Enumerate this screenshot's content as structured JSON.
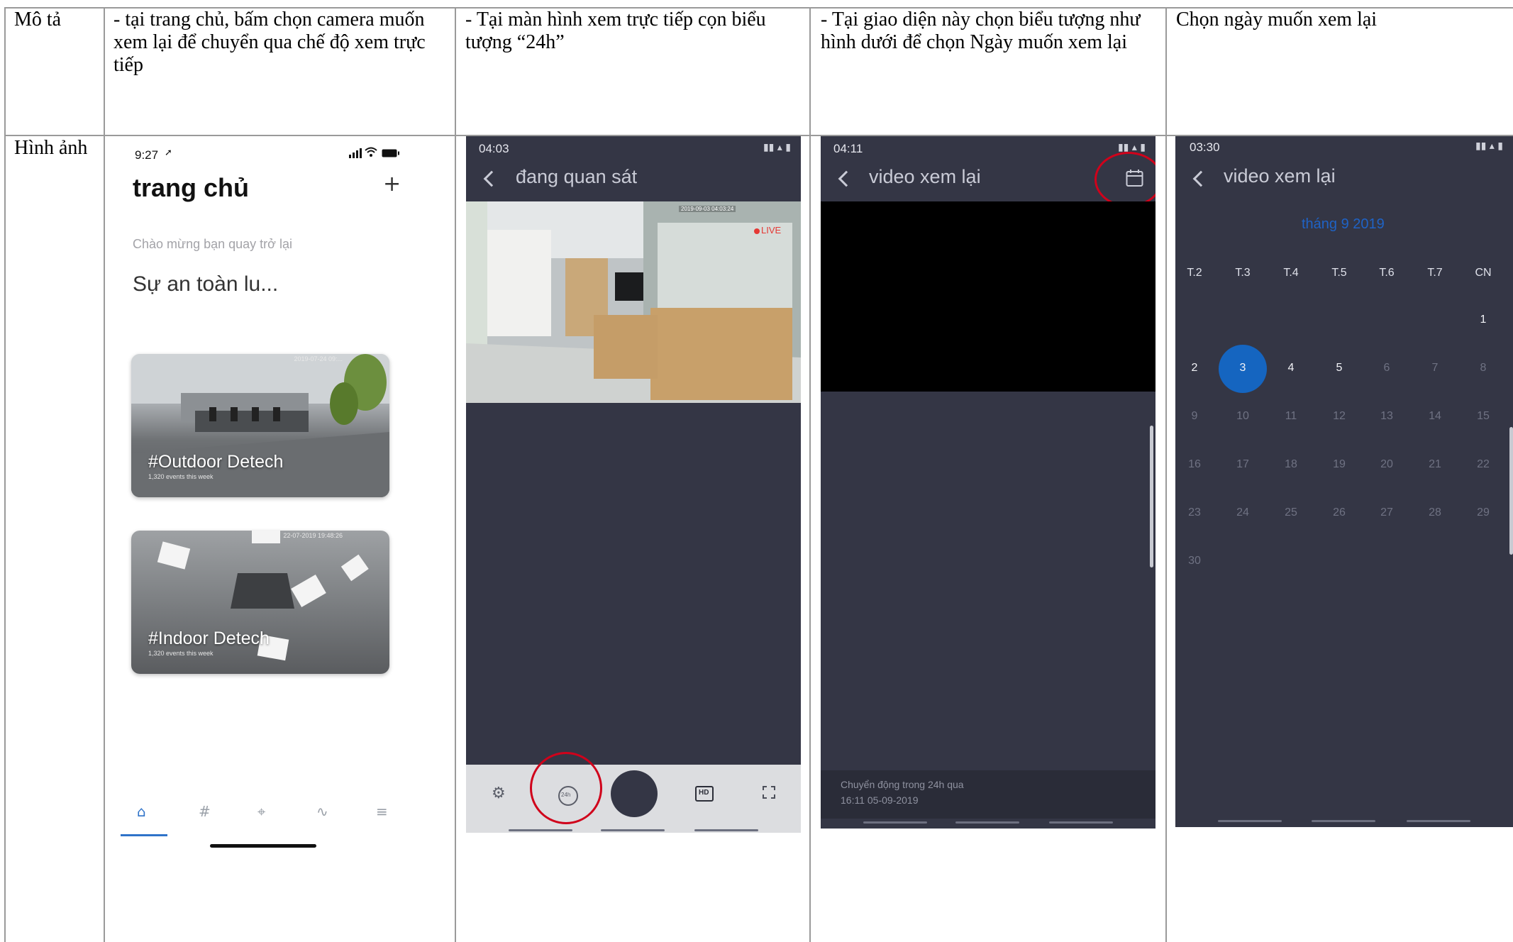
{
  "table": {
    "row_labels": {
      "description": "Mô tả",
      "image": "Hình ảnh"
    },
    "descriptions": [
      "- tại trang chủ, bấm chọn camera muốn xem lại để chuyển qua chế độ xem trực tiếp",
      "- Tại màn hình xem trực tiếp cọn biểu tượng  “24h”",
      "- Tại giao diện này chọn biểu tượng như hình dưới để chọn Ngày muốn xem lại",
      "Chọn ngày muốn xem lại"
    ]
  },
  "panel_home": {
    "time": "9:27",
    "title": "trang chủ",
    "add_icon": "plus-icon",
    "welcome": "Chào mừng bạn quay trở lại",
    "headline": "Sự an toàn lu...",
    "cameras": [
      {
        "name": "#Outdoor Detech",
        "events": "1,320 events this week",
        "timestamp": "2019-07-24 09:..."
      },
      {
        "name": "#Indoor Detech",
        "events": "1,320 events this week",
        "timestamp": "22-07-2019 19:48:26"
      }
    ],
    "tabs": [
      "home-icon",
      "hash-icon",
      "crosshair-icon",
      "activity-icon",
      "menu-icon"
    ],
    "tab_glyphs": [
      "⌂",
      "#",
      "⌖",
      "∿",
      "≡"
    ]
  },
  "panel_live": {
    "time": "04:03",
    "title": "đang quan sát",
    "live_badge": "LIVE",
    "video_timestamp": "2019-09-03 04:03:24",
    "controls": [
      "settings-icon",
      "history-24h-icon",
      "record-button",
      "hd-icon",
      "fullscreen-icon"
    ],
    "history_label": "24h",
    "hd_label": "HD"
  },
  "panel_playback": {
    "time": "04:11",
    "title": "video xem lại",
    "calendar_icon": "calendar-icon",
    "motion_title": "Chuyển động trong 24h qua",
    "motion_time": "16:11 05-09-2019"
  },
  "panel_calendar": {
    "time": "03:30",
    "title": "video xem lại",
    "month": "tháng 9 2019",
    "weekdays": [
      "T.2",
      "T.3",
      "T.4",
      "T.5",
      "T.6",
      "T.7",
      "CN"
    ],
    "selected_day": "3",
    "accent": "#1565c0"
  }
}
